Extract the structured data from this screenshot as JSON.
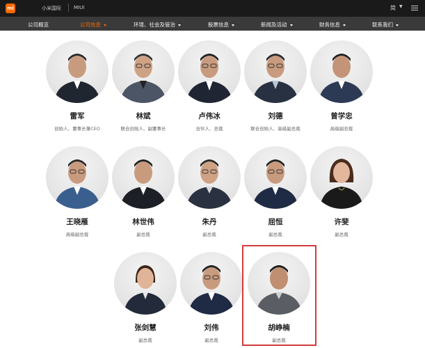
{
  "topbar": {
    "logo": "mi",
    "links": [
      "小米国际",
      "MIUI"
    ],
    "language": "简"
  },
  "nav": {
    "items": [
      {
        "label": "公司概览",
        "dropdown": false,
        "active": false
      },
      {
        "label": "公司信息",
        "dropdown": true,
        "active": true
      },
      {
        "label": "环境、社会及管治",
        "dropdown": true,
        "active": false
      },
      {
        "label": "股票信息",
        "dropdown": true,
        "active": false
      },
      {
        "label": "新闻及活动",
        "dropdown": true,
        "active": false
      },
      {
        "label": "财务信息",
        "dropdown": true,
        "active": false
      },
      {
        "label": "联系我们",
        "dropdown": true,
        "active": false
      }
    ]
  },
  "leaders": [
    {
      "name": "雷军",
      "title": "创始人、董事长兼CEO"
    },
    {
      "name": "林斌",
      "title": "联合创始人、副董事长"
    },
    {
      "name": "卢伟冰",
      "title": "合伙人、总裁"
    },
    {
      "name": "刘德",
      "title": "联合创始人、高级副总裁"
    },
    {
      "name": "曾学忠",
      "title": "高级副总裁"
    },
    {
      "name": "王晓雁",
      "title": "高级副总裁"
    },
    {
      "name": "林世伟",
      "title": "副总裁"
    },
    {
      "name": "朱丹",
      "title": "副总裁"
    },
    {
      "name": "屈恒",
      "title": "副总裁"
    },
    {
      "name": "许斐",
      "title": "副总裁"
    },
    {
      "name": "张剑慧",
      "title": "副总裁"
    },
    {
      "name": "刘伟",
      "title": "副总裁"
    },
    {
      "name": "胡峥楠",
      "title": "副总裁"
    }
  ],
  "colors": {
    "accent": "#ff6900",
    "topbar": "#1a1a1a",
    "navbar": "#3a3a3a",
    "highlight_border": "#d33a3a"
  }
}
